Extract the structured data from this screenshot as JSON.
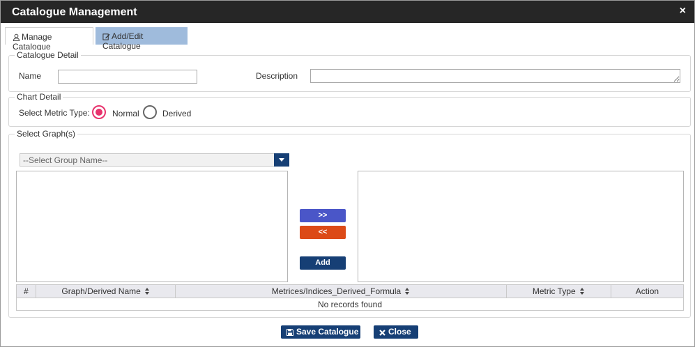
{
  "window": {
    "title": "Catalogue Management",
    "close_glyph": "×"
  },
  "tabs": [
    {
      "label": "Manage Catalogue",
      "icon": "user-icon",
      "active": true
    },
    {
      "label": "Add/Edit Catalogue",
      "icon": "edit-icon",
      "active": false
    }
  ],
  "catalogue_detail": {
    "legend": "Catalogue Detail",
    "name_label": "Name",
    "name_value": "",
    "description_label": "Description",
    "description_value": ""
  },
  "chart_detail": {
    "legend": "Chart Detail",
    "metric_type_label": "Select Metric Type:",
    "options": [
      {
        "label": "Normal",
        "checked": true
      },
      {
        "label": "Derived",
        "checked": false
      }
    ],
    "accent_color": "#e8336d"
  },
  "select_graphs": {
    "legend": "Select Graph(s)",
    "group_select_value": "--Select Group Name--",
    "move_right_label": ">>",
    "move_left_label": "<<",
    "add_label": "Add"
  },
  "table": {
    "columns": [
      "#",
      "Graph/Derived Name",
      "Metrices/Indices_Derived_Formula",
      "Metric Type",
      "Action"
    ],
    "empty_message": "No records found"
  },
  "footer": {
    "save_label": "Save Catalogue",
    "close_label": "Close"
  },
  "colors": {
    "titlebar": "#262626",
    "primary": "#163f75",
    "move_right": "#4a56c8",
    "move_left": "#dc4a17",
    "tab_inactive": "#9fbbdc"
  }
}
